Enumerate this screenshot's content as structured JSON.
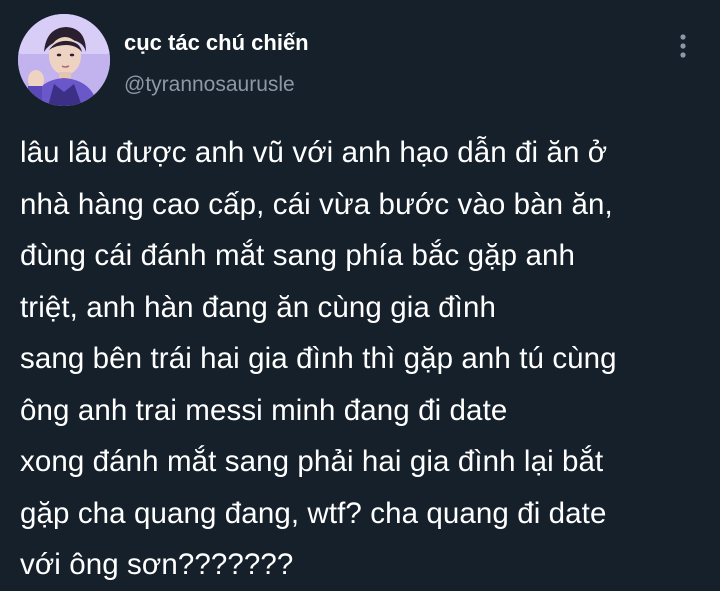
{
  "author": {
    "display_name": "cục tác chú chiến",
    "handle": "@tyrannosaurusle",
    "avatar_icon": "profile-photo"
  },
  "more_icon": "more-vertical-icon",
  "tweet": {
    "lines": [
      "lâu lâu được anh vũ với anh hạo dẫn đi ăn ở",
      "nhà hàng cao cấp, cái vừa bước vào bàn ăn,",
      "đùng cái đánh mắt sang phía bắc gặp anh",
      "triệt, anh hàn đang ăn cùng gia đình",
      "sang bên trái hai gia đình thì gặp anh tú cùng",
      "ông anh trai messi minh đang đi date",
      "xong đánh mắt sang phải hai gia đình lại bắt",
      "gặp cha quang đang, wtf? cha quang đi date",
      "với ông sơn???????"
    ]
  },
  "colors": {
    "background": "#15202b",
    "text": "#ffffff",
    "secondary_text": "#8b98a5"
  }
}
